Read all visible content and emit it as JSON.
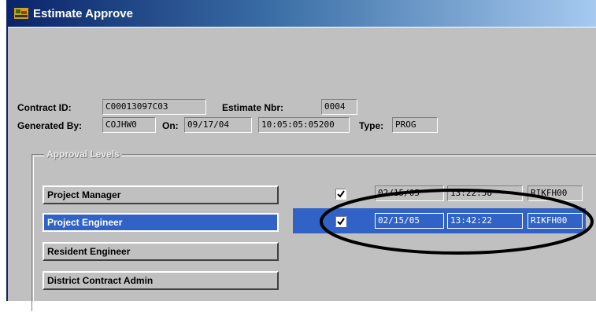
{
  "window": {
    "title": "Estimate Approve"
  },
  "header": {
    "contract_id_label": "Contract ID:",
    "contract_id_value": "C00013097C03",
    "estimate_nbr_label": "Estimate Nbr:",
    "estimate_nbr_value": "0004",
    "generated_by_label": "Generated By:",
    "generated_by_value": "COJHW0",
    "on_label": "On:",
    "on_date_value": "09/17/04",
    "on_time_value": "10:05:05:05200",
    "type_label": "Type:",
    "type_value": "PROG"
  },
  "approval_levels": {
    "legend": "Approval Levels",
    "items": [
      {
        "label": "Project Manager",
        "checked": true,
        "date": "02/15/05",
        "time": "13:22:58",
        "user": "RIKFH00"
      },
      {
        "label": "Project Engineer",
        "checked": true,
        "date": "02/15/05",
        "time": "13:42:22",
        "user": "RIKFH00"
      },
      {
        "label": "Resident Engineer"
      },
      {
        "label": "District Contract Admin"
      }
    ]
  },
  "colors": {
    "selection": "#3163c6",
    "window_bg": "#c0c0c0",
    "title_bar": "#0a246a"
  }
}
